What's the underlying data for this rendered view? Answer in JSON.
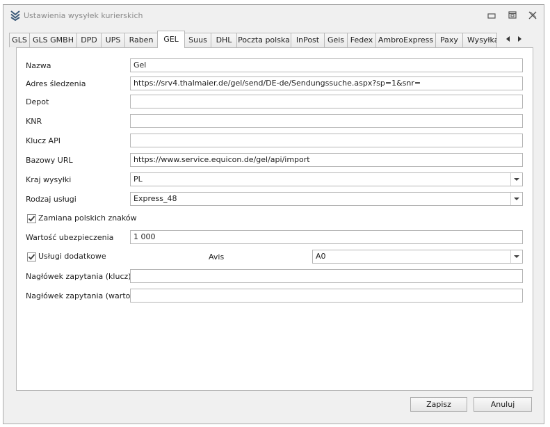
{
  "window": {
    "title": "Ustawienia wysyłek kurierskich",
    "icons": {
      "app": "layers-chevron-icon",
      "minimize": "minimize-icon",
      "maximize": "restore-icon",
      "close": "close-icon"
    }
  },
  "tabs": [
    {
      "label": "GLS",
      "active": false
    },
    {
      "label": "GLS GMBH",
      "active": false
    },
    {
      "label": "DPD",
      "active": false
    },
    {
      "label": "UPS",
      "active": false
    },
    {
      "label": "Raben",
      "active": false
    },
    {
      "label": "GEL",
      "active": true
    },
    {
      "label": "Suus",
      "active": false
    },
    {
      "label": "DHL",
      "active": false
    },
    {
      "label": "Poczta polska",
      "active": false
    },
    {
      "label": "InPost",
      "active": false
    },
    {
      "label": "Geis",
      "active": false
    },
    {
      "label": "Fedex",
      "active": false
    },
    {
      "label": "AmbroExpress",
      "active": false
    },
    {
      "label": "Paxy",
      "active": false
    },
    {
      "label": "Wysyłka",
      "active": false
    }
  ],
  "form": {
    "nazwa": {
      "label": "Nazwa",
      "value": "Gel"
    },
    "adres": {
      "label": "Adres śledzenia",
      "value": "https://srv4.thalmaier.de/gel/send/DE-de/Sendungssuche.aspx?sp=1&snr="
    },
    "depot": {
      "label": "Depot",
      "value": ""
    },
    "knr": {
      "label": "KNR",
      "value": ""
    },
    "klucz": {
      "label": "Klucz API",
      "value": ""
    },
    "bazowy": {
      "label": "Bazowy URL",
      "value": "https://www.service.equicon.de/gel/api/import"
    },
    "kraj": {
      "label": "Kraj wysyłki",
      "value": "PL"
    },
    "rodzaj": {
      "label": "Rodzaj usługi",
      "value": "Express_48"
    },
    "zamiana": {
      "label": "Zamiana polskich znaków",
      "checked": true
    },
    "wartosc": {
      "label": "Wartość ubezpieczenia",
      "value": "1 000"
    },
    "uslugi": {
      "label": "Usługi dodatkowe",
      "checked": true
    },
    "avis": {
      "label": "Avis",
      "value": "A0"
    },
    "naglowek_klucz": {
      "label": "Nagłówek zapytania (klucz)",
      "value": ""
    },
    "naglowek_wartosc": {
      "label": "Nagłówek zapytania (wartość)",
      "value": ""
    }
  },
  "buttons": {
    "save": "Zapisz",
    "cancel": "Anuluj"
  },
  "colors": {
    "check": "#3a3a3a",
    "border": "#b5b5b5",
    "window_bg": "#f0f0f0",
    "app_icon": "#3b5a78"
  }
}
